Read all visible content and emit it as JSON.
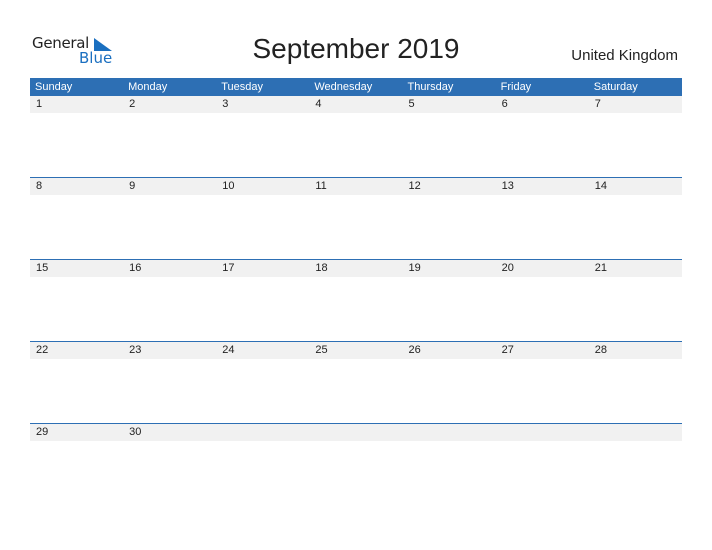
{
  "logo": {
    "line1": "General",
    "line2": "Blue",
    "brand_color": "#1a6fc0"
  },
  "title": "September 2019",
  "country": "United Kingdom",
  "header_color": "#2d6fb4",
  "weekdays": [
    "Sunday",
    "Monday",
    "Tuesday",
    "Wednesday",
    "Thursday",
    "Friday",
    "Saturday"
  ],
  "weeks": [
    [
      "1",
      "2",
      "3",
      "4",
      "5",
      "6",
      "7"
    ],
    [
      "8",
      "9",
      "10",
      "11",
      "12",
      "13",
      "14"
    ],
    [
      "15",
      "16",
      "17",
      "18",
      "19",
      "20",
      "21"
    ],
    [
      "22",
      "23",
      "24",
      "25",
      "26",
      "27",
      "28"
    ],
    [
      "29",
      "30",
      "",
      "",
      "",
      "",
      ""
    ]
  ]
}
